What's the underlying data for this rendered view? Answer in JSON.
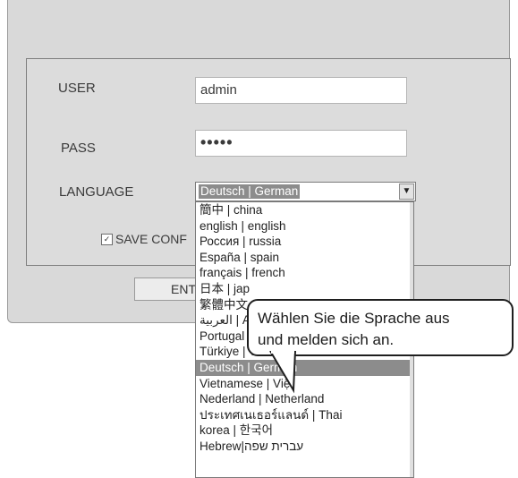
{
  "login": {
    "user_label": "USER",
    "user_value": "admin",
    "pass_label": "PASS",
    "pass_value": "•••••",
    "language_label": "LANGUAGE",
    "language_selected": "Deutsch | German",
    "save_conf_label": "SAVE CONF",
    "enter_label": "ENT"
  },
  "dropdown": {
    "items": [
      "簡中 | china",
      "english | english",
      "Россия | russia",
      " España | spain",
      "français | french",
      "日本 | jap",
      "繁體中文",
      "العربية | A",
      "Portugal | ",
      "Türkiye | Turkey",
      "Deutsch | German",
      "Vietnamese | Việt",
      "Nederland | Netherland",
      "ประเทศเนเธอร์แลนด์ | Thai",
      " korea | 한국어",
      " Hebrew|עברית שפה"
    ],
    "selected_index": 10
  },
  "callout": {
    "line1": "Wählen Sie die Sprache aus",
    "line2": "und melden sich an."
  }
}
